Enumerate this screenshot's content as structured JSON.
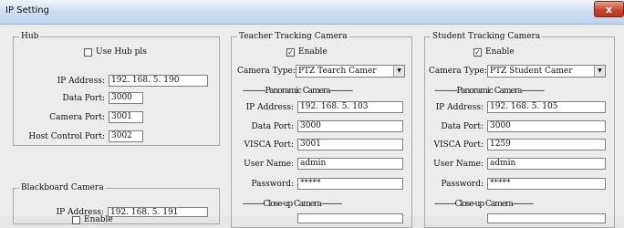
{
  "window": {
    "title": "IP Setting",
    "close_glyph": "x"
  },
  "hub": {
    "group_title": "Hub",
    "use_hub_label": "Use Hub pls",
    "use_hub_checked": false,
    "ip_label": "IP Address:",
    "ip_value": "192. 168. 5. 190",
    "data_port_label": "Data Port:",
    "data_port_value": "3000",
    "camera_port_label": "Camera Port:",
    "camera_port_value": "3001",
    "host_port_label": "Host Control Port:",
    "host_port_value": "3002"
  },
  "blackboard": {
    "group_title": "Blackboard Camera",
    "enable_label": "Enable",
    "enable_checked": false,
    "ip_label": "IP Address:",
    "ip_value": "192. 168. 5. 191"
  },
  "teacher": {
    "group_title": "Teacher Tracking Camera",
    "enable_label": "Enable",
    "enable_checked": true,
    "camera_type_label": "Camera Type:",
    "camera_type_value": "PTZ Tearch Camer",
    "panoramic_label": "------------Panoramic Camera------------",
    "ip_label": "IP Address:",
    "ip_value": "192. 168. 5. 103",
    "data_port_label": "Data Port:",
    "data_port_value": "3000",
    "visca_port_label": "VISCA Port:",
    "visca_port_value": "3001",
    "user_name_label": "User Name:",
    "user_name_value": "admin",
    "password_label": "Password:",
    "password_value": "*****",
    "closeup_label": "-----------Close-up Camera-----------"
  },
  "student": {
    "group_title": "Student Tracking Camera",
    "enable_label": "Enable",
    "enable_checked": true,
    "camera_type_label": "Camera Type:",
    "camera_type_value": "PTZ Student Camer",
    "panoramic_label": "------------Panoramic Camera------------",
    "ip_label": "IP Address:",
    "ip_value": "192. 168. 5. 105",
    "data_port_label": "Data Port:",
    "data_port_value": "3000",
    "visca_port_label": "VISCA Port:",
    "visca_port_value": "1259",
    "user_name_label": "User Name:",
    "user_name_value": "admin",
    "password_label": "Password:",
    "password_value": "*****",
    "closeup_label": "-----------Close-up Camera-----------"
  }
}
